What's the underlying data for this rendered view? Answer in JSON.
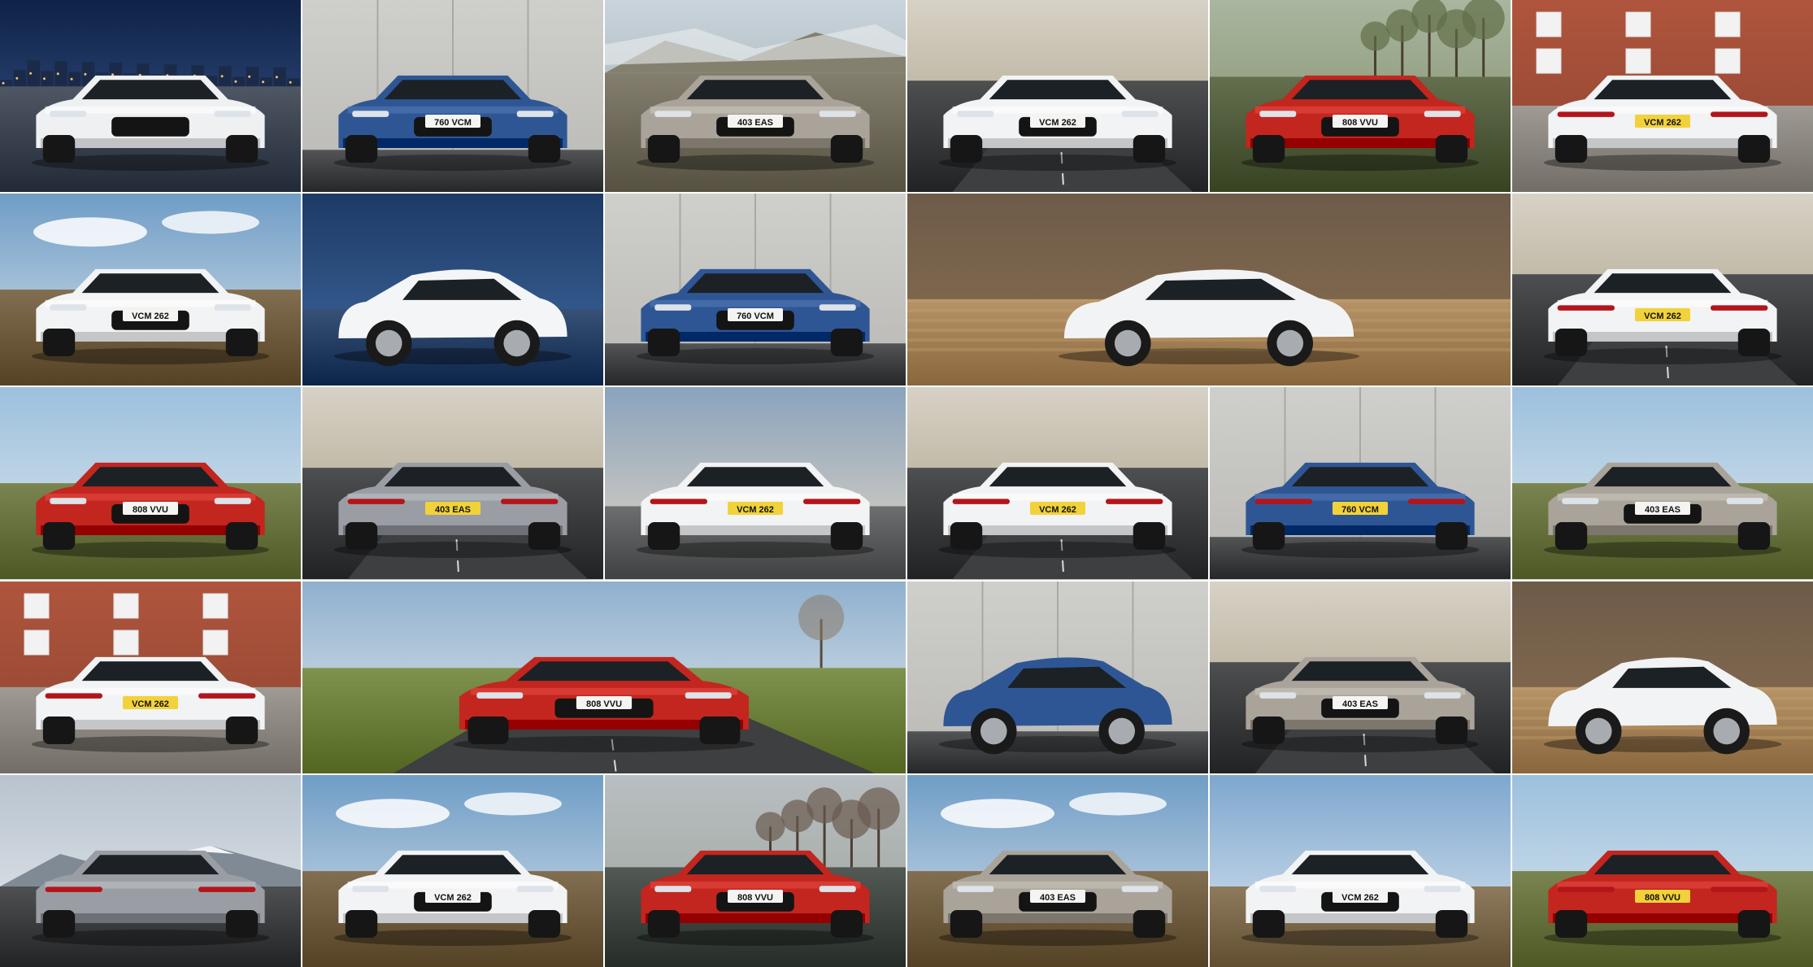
{
  "collage": {
    "tiles": [
      {
        "plate": "",
        "car_color": "#eef0f2",
        "scene": "night-city",
        "view": "front-3q"
      },
      {
        "plate": "760 VCM",
        "car_color": "#2f5694",
        "scene": "studio-wall",
        "view": "front"
      },
      {
        "plate": "403 EAS",
        "car_color": "#a9a39a",
        "scene": "moor",
        "view": "front-3q"
      },
      {
        "plate": "VCM 262",
        "car_color": "#f2f3f4",
        "scene": "moor-road",
        "view": "front"
      },
      {
        "plate": "808 VVU",
        "car_color": "#c2261f",
        "scene": "splash-field",
        "view": "front"
      },
      {
        "plate": "VCM 262",
        "car_color": "#f2f3f4",
        "scene": "brick-house",
        "view": "rear-3q"
      },
      {
        "plate": "VCM 262",
        "car_color": "#f2f3f4",
        "scene": "moor-sky",
        "view": "front-3q"
      },
      {
        "plate": "",
        "car_color": "#f4f5f6",
        "scene": "blue-blur",
        "view": "side-top"
      },
      {
        "plate": "760 VCM",
        "car_color": "#2f5694",
        "scene": "studio-wall",
        "view": "front-3q"
      },
      {
        "plate": "",
        "car_color": "#f2f3f4",
        "scene": "moor-blur",
        "view": "side",
        "wide": true
      },
      {
        "plate": "VCM 262",
        "car_color": "#f2f3f4",
        "scene": "moor-road",
        "view": "rear"
      },
      {
        "plate": "808 VVU",
        "car_color": "#c2261f",
        "scene": "field-sky",
        "view": "front-3q"
      },
      {
        "plate": "403 EAS",
        "car_color": "#9a9ea4",
        "scene": "moor-road",
        "view": "rear"
      },
      {
        "plate": "VCM 262",
        "car_color": "#f2f3f4",
        "scene": "sky-dusk",
        "view": "rear-3q"
      },
      {
        "plate": "VCM 262",
        "car_color": "#f2f3f4",
        "scene": "moor-road",
        "view": "rear"
      },
      {
        "plate": "760 VCM",
        "car_color": "#2f5694",
        "scene": "studio-wall",
        "view": "rear-3q"
      },
      {
        "plate": "403 EAS",
        "car_color": "#a9a39a",
        "scene": "field-sky",
        "view": "front-3q"
      },
      {
        "plate": "VCM 262",
        "car_color": "#f2f3f4",
        "scene": "brick-house",
        "view": "rear-3q"
      },
      {
        "plate": "808 VVU",
        "car_color": "#c2261f",
        "scene": "country-road",
        "view": "front-3q",
        "wide": true
      },
      {
        "plate": "",
        "car_color": "#2f5694",
        "scene": "studio-wall",
        "view": "side"
      },
      {
        "plate": "403 EAS",
        "car_color": "#a9a39a",
        "scene": "moor-road",
        "view": "front"
      },
      {
        "plate": "",
        "car_color": "#f2f3f4",
        "scene": "moor-blur",
        "view": "side"
      },
      {
        "plate": "",
        "car_color": "#9a9ea4",
        "scene": "mountain",
        "view": "rear-3q"
      },
      {
        "plate": "VCM 262",
        "car_color": "#f2f3f4",
        "scene": "moor-sky",
        "view": "front-3q"
      },
      {
        "plate": "808 VVU",
        "car_color": "#c2261f",
        "scene": "splash-trees",
        "view": "front"
      },
      {
        "plate": "403 EAS",
        "car_color": "#a9a39a",
        "scene": "moor-sky",
        "view": "front-3q"
      },
      {
        "plate": "VCM 262",
        "car_color": "#f2f3f4",
        "scene": "sky-blue",
        "view": "front-3q"
      },
      {
        "plate": "808 VVU",
        "car_color": "#c2261f",
        "scene": "field-sky",
        "view": "rear-3q"
      }
    ]
  }
}
